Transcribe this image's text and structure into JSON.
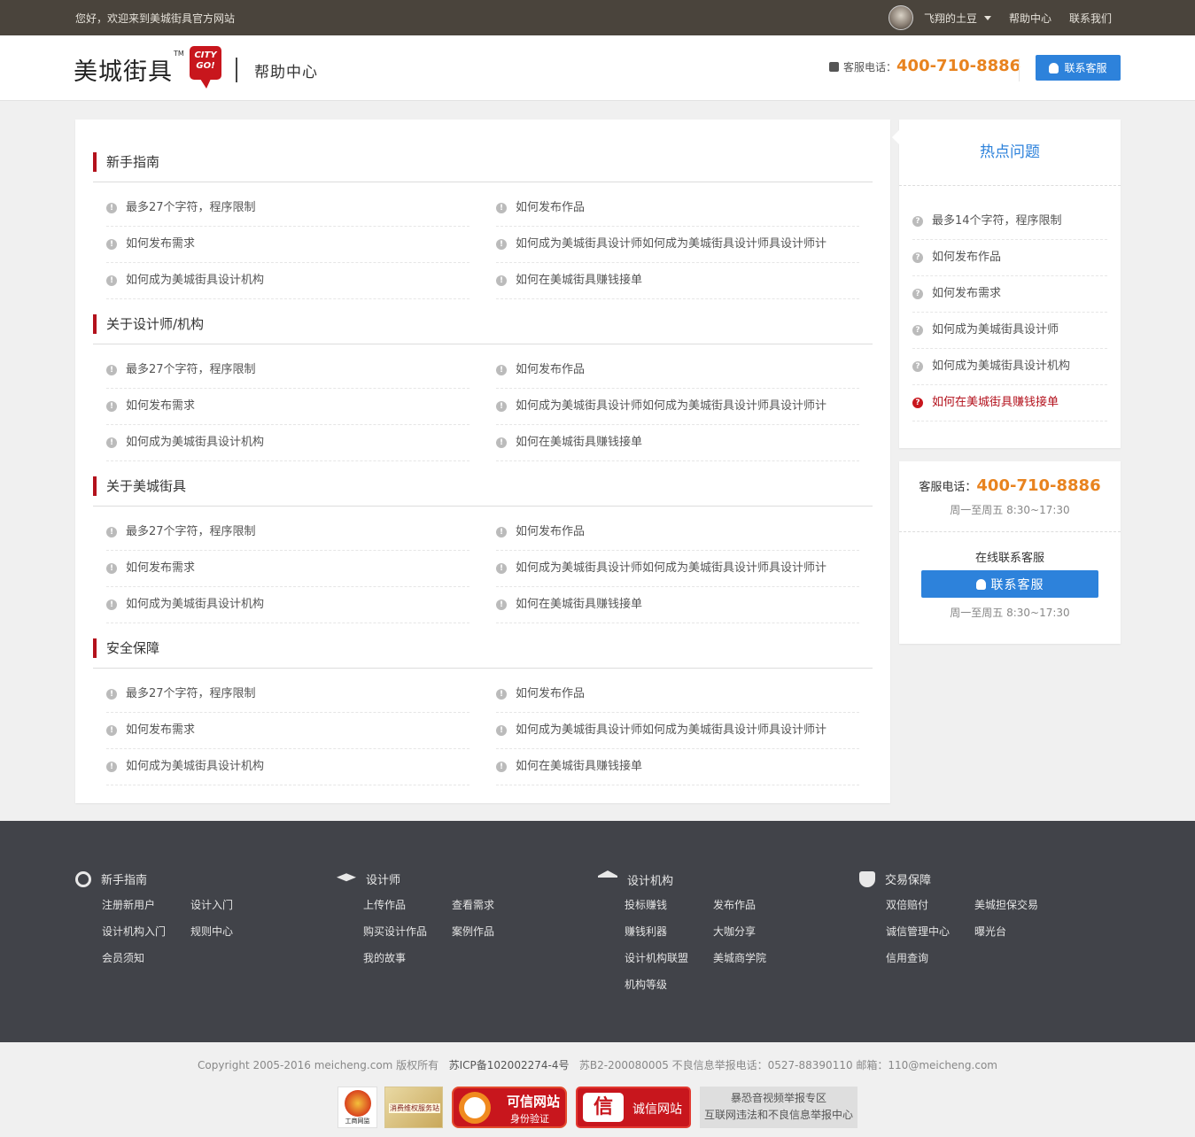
{
  "topbar": {
    "welcome": "您好，欢迎来到美城街具官方网站",
    "username": "飞翔的土豆",
    "links": [
      "帮助中心",
      "联系我们"
    ]
  },
  "header": {
    "logo_text": "美城街具",
    "logo_tm": "TM",
    "logo_badge_line1": "CITY",
    "logo_badge_line2": "GO!",
    "page_title": "帮助中心",
    "phone_label": "客服电话：",
    "phone_number": "400-710-8886",
    "contact_button": "联系客服"
  },
  "sections": [
    {
      "title": "新手指南",
      "items": [
        "最多27个字符，程序限制",
        "如何发布作品",
        "如何发布需求",
        "如何成为美城街具设计师如何成为美城街具设计师具设计师计",
        "如何成为美城街具设计机构",
        "如何在美城街具赚钱接单"
      ]
    },
    {
      "title": "关于设计师/机构",
      "items": [
        "最多27个字符，程序限制",
        "如何发布作品",
        "如何发布需求",
        "如何成为美城街具设计师如何成为美城街具设计师具设计师计",
        "如何成为美城街具设计机构",
        "如何在美城街具赚钱接单"
      ]
    },
    {
      "title": "关于美城街具",
      "items": [
        "最多27个字符，程序限制",
        "如何发布作品",
        "如何发布需求",
        "如何成为美城街具设计师如何成为美城街具设计师具设计师计",
        "如何成为美城街具设计机构",
        "如何在美城街具赚钱接单"
      ]
    },
    {
      "title": "安全保障",
      "items": [
        "最多27个字符，程序限制",
        "如何发布作品",
        "如何发布需求",
        "如何成为美城街具设计师如何成为美城街具设计师具设计师计",
        "如何成为美城街具设计机构",
        "如何在美城街具赚钱接单"
      ]
    }
  ],
  "hot": {
    "title": "热点问题",
    "items": [
      "最多14个字符，程序限制",
      "如何发布作品",
      "如何发布需求",
      "如何成为美城街具设计师",
      "如何成为美城街具设计机构",
      "如何在美城街具赚钱接单"
    ],
    "active_index": 5
  },
  "service": {
    "phone_label": "客服电话：",
    "phone_number": "400-710-8886",
    "hours": "周一至周五 8:30~17:30",
    "online_label": "在线联系客服",
    "button": "联系客服",
    "hours2": "周一至周五 8:30~17:30"
  },
  "footer": {
    "columns": [
      {
        "title": "新手指南",
        "icon": "compass-icon",
        "links": [
          "注册新用户",
          "设计入门",
          "设计机构入门",
          "规则中心",
          "会员须知"
        ]
      },
      {
        "title": "设计师",
        "icon": "graduation-cap-icon",
        "links": [
          "上传作品",
          "查看需求",
          "购买设计作品",
          "案例作品",
          "我的故事"
        ]
      },
      {
        "title": "设计机构",
        "icon": "bank-icon",
        "links": [
          "投标赚钱",
          "发布作品",
          "赚钱利器",
          "大咖分享",
          "设计机构联盟",
          "美城商学院",
          "机构等级"
        ]
      },
      {
        "title": "交易保障",
        "icon": "shield-check-icon",
        "links": [
          "双倍赔付",
          "美城担保交易",
          "诚信管理中心",
          "曝光台",
          "信用查询"
        ]
      }
    ],
    "copyright_a": "Copyright 2005-2016 meicheng.com 版权所有",
    "icp": "苏ICP备102002274-4号",
    "copyright_b": "苏B2-200080005 不良信息举报电话：0527-88390110 邮箱：110@meicheng.com",
    "badges": {
      "b1": "工商网监",
      "b2": "消费维权服务站",
      "b3_line1": "可信网站",
      "b3_line2": "身份验证",
      "b4_glyph": "信",
      "b4_text": "诚信网站",
      "b5_line1": "暴恐音视频举报专区",
      "b5_line2": "互联网违法和不良信息举报中心"
    }
  },
  "colors": {
    "accent_blue": "#2d82db",
    "phone_orange": "#e8831f",
    "brand_red": "#c8161d",
    "topbar": "#4a443c",
    "footer": "#414349"
  }
}
